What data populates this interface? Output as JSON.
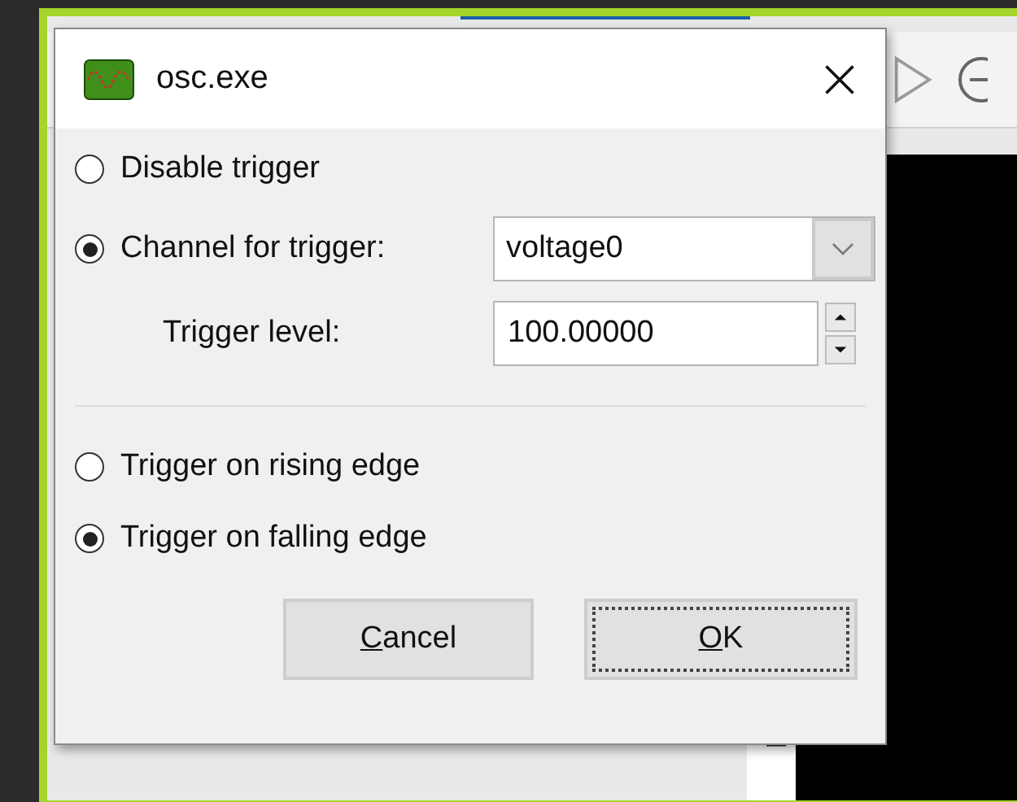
{
  "dialog": {
    "title": "osc.exe",
    "source": {
      "options": [
        {
          "label": "Disable trigger",
          "selected": false
        },
        {
          "label": "Channel for trigger:",
          "selected": true
        }
      ],
      "channel": "voltage0",
      "level_label": "Trigger level:",
      "level_value": "100.00000"
    },
    "edge": {
      "options": [
        {
          "label": "Trigger on rising edge",
          "selected": false
        },
        {
          "label": "Trigger on falling edge",
          "selected": true
        }
      ]
    },
    "buttons": [
      {
        "mnemonic": "C",
        "rest": "ancel",
        "default": false
      },
      {
        "mnemonic": "O",
        "rest": "K",
        "default": true
      }
    ]
  }
}
